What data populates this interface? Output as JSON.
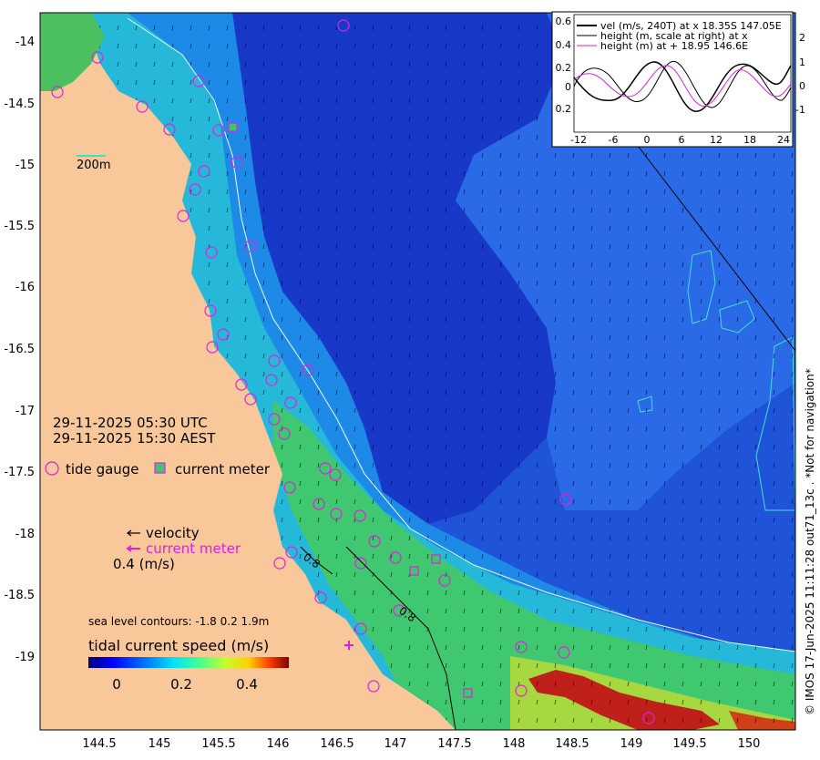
{
  "map": {
    "lat_ticks": [
      "-14",
      "-14.5",
      "-15",
      "-15.5",
      "-16",
      "-16.5",
      "-17",
      "-17.5",
      "-18",
      "-18.5",
      "-19"
    ],
    "lon_ticks": [
      "144.5",
      "145",
      "145.5",
      "146",
      "146.5",
      "147",
      "147.5",
      "148",
      "148.5",
      "149",
      "149.5",
      "150"
    ],
    "scale_bar": "200m",
    "timestamp_utc": "29-11-2025 05:30 UTC",
    "timestamp_local": "29-11-2025 15:30 AEST",
    "colors": {
      "land": "#f9c89a",
      "deep": "#1a3fd1",
      "mid": "#1e7fe8",
      "shallow": "#2fd0c8",
      "green": "#3cc86a",
      "yellow": "#d8e04a",
      "red": "#b01010",
      "gauge": "#e020e0"
    },
    "contour_labels": [
      "0.8",
      "0.8"
    ]
  },
  "legend": {
    "tide_gauge": "tide gauge",
    "current_meter": "current meter",
    "velocity": "velocity",
    "current_meter_arrow": "current meter",
    "scale_speed": "0.4 (m/s)",
    "contours": "sea level contours: -1.8  0.2  1.9m"
  },
  "colorbar": {
    "title": "tidal current speed (m/s)",
    "ticks": [
      "0",
      "0.2",
      "0.4"
    ]
  },
  "inset": {
    "legend": [
      "vel (m/s, 240T) at x 18.35S 147.05E",
      "height (m, scale at right) at x",
      "height (m) at + 18.95 146.6E"
    ],
    "left_ticks": [
      "0.6",
      "0.4",
      "0.2",
      "0",
      "0.2"
    ],
    "right_ticks": [
      "2",
      "1",
      "0",
      "-1"
    ],
    "x_ticks": [
      "-12",
      "-6",
      "0",
      "6",
      "12",
      "18",
      "24"
    ]
  },
  "credit": "© IMOS 17-Jun-2025 11:11:28 out71_13c . *Not for navigation*"
}
